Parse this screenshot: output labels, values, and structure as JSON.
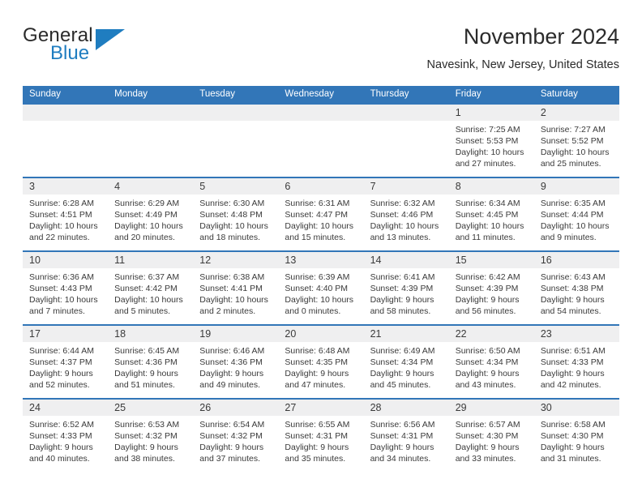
{
  "logo": {
    "word_general": "General",
    "word_blue": "Blue",
    "triangle": "triangle-mark"
  },
  "header": {
    "title": "November 2024",
    "subtitle": "Navesink, New Jersey, United States"
  },
  "colors": {
    "header_blue": "#3276b8",
    "daynum_band": "#efeff0",
    "text": "#3a3a3a",
    "logo_blue": "#1f7dc0"
  },
  "weekday_headers": [
    "Sunday",
    "Monday",
    "Tuesday",
    "Wednesday",
    "Thursday",
    "Friday",
    "Saturday"
  ],
  "labels": {
    "sunrise_prefix": "Sunrise:",
    "sunset_prefix": "Sunset:",
    "daylight_prefix": "Daylight:"
  },
  "weeks": [
    [
      {
        "day": "",
        "sunrise": "",
        "sunset": "",
        "daylight_line1": "",
        "daylight_line2": ""
      },
      {
        "day": "",
        "sunrise": "",
        "sunset": "",
        "daylight_line1": "",
        "daylight_line2": ""
      },
      {
        "day": "",
        "sunrise": "",
        "sunset": "",
        "daylight_line1": "",
        "daylight_line2": ""
      },
      {
        "day": "",
        "sunrise": "",
        "sunset": "",
        "daylight_line1": "",
        "daylight_line2": ""
      },
      {
        "day": "",
        "sunrise": "",
        "sunset": "",
        "daylight_line1": "",
        "daylight_line2": ""
      },
      {
        "day": "1",
        "sunrise": "Sunrise: 7:25 AM",
        "sunset": "Sunset: 5:53 PM",
        "daylight_line1": "Daylight: 10 hours",
        "daylight_line2": "and 27 minutes."
      },
      {
        "day": "2",
        "sunrise": "Sunrise: 7:27 AM",
        "sunset": "Sunset: 5:52 PM",
        "daylight_line1": "Daylight: 10 hours",
        "daylight_line2": "and 25 minutes."
      }
    ],
    [
      {
        "day": "3",
        "sunrise": "Sunrise: 6:28 AM",
        "sunset": "Sunset: 4:51 PM",
        "daylight_line1": "Daylight: 10 hours",
        "daylight_line2": "and 22 minutes."
      },
      {
        "day": "4",
        "sunrise": "Sunrise: 6:29 AM",
        "sunset": "Sunset: 4:49 PM",
        "daylight_line1": "Daylight: 10 hours",
        "daylight_line2": "and 20 minutes."
      },
      {
        "day": "5",
        "sunrise": "Sunrise: 6:30 AM",
        "sunset": "Sunset: 4:48 PM",
        "daylight_line1": "Daylight: 10 hours",
        "daylight_line2": "and 18 minutes."
      },
      {
        "day": "6",
        "sunrise": "Sunrise: 6:31 AM",
        "sunset": "Sunset: 4:47 PM",
        "daylight_line1": "Daylight: 10 hours",
        "daylight_line2": "and 15 minutes."
      },
      {
        "day": "7",
        "sunrise": "Sunrise: 6:32 AM",
        "sunset": "Sunset: 4:46 PM",
        "daylight_line1": "Daylight: 10 hours",
        "daylight_line2": "and 13 minutes."
      },
      {
        "day": "8",
        "sunrise": "Sunrise: 6:34 AM",
        "sunset": "Sunset: 4:45 PM",
        "daylight_line1": "Daylight: 10 hours",
        "daylight_line2": "and 11 minutes."
      },
      {
        "day": "9",
        "sunrise": "Sunrise: 6:35 AM",
        "sunset": "Sunset: 4:44 PM",
        "daylight_line1": "Daylight: 10 hours",
        "daylight_line2": "and 9 minutes."
      }
    ],
    [
      {
        "day": "10",
        "sunrise": "Sunrise: 6:36 AM",
        "sunset": "Sunset: 4:43 PM",
        "daylight_line1": "Daylight: 10 hours",
        "daylight_line2": "and 7 minutes."
      },
      {
        "day": "11",
        "sunrise": "Sunrise: 6:37 AM",
        "sunset": "Sunset: 4:42 PM",
        "daylight_line1": "Daylight: 10 hours",
        "daylight_line2": "and 5 minutes."
      },
      {
        "day": "12",
        "sunrise": "Sunrise: 6:38 AM",
        "sunset": "Sunset: 4:41 PM",
        "daylight_line1": "Daylight: 10 hours",
        "daylight_line2": "and 2 minutes."
      },
      {
        "day": "13",
        "sunrise": "Sunrise: 6:39 AM",
        "sunset": "Sunset: 4:40 PM",
        "daylight_line1": "Daylight: 10 hours",
        "daylight_line2": "and 0 minutes."
      },
      {
        "day": "14",
        "sunrise": "Sunrise: 6:41 AM",
        "sunset": "Sunset: 4:39 PM",
        "daylight_line1": "Daylight: 9 hours",
        "daylight_line2": "and 58 minutes."
      },
      {
        "day": "15",
        "sunrise": "Sunrise: 6:42 AM",
        "sunset": "Sunset: 4:39 PM",
        "daylight_line1": "Daylight: 9 hours",
        "daylight_line2": "and 56 minutes."
      },
      {
        "day": "16",
        "sunrise": "Sunrise: 6:43 AM",
        "sunset": "Sunset: 4:38 PM",
        "daylight_line1": "Daylight: 9 hours",
        "daylight_line2": "and 54 minutes."
      }
    ],
    [
      {
        "day": "17",
        "sunrise": "Sunrise: 6:44 AM",
        "sunset": "Sunset: 4:37 PM",
        "daylight_line1": "Daylight: 9 hours",
        "daylight_line2": "and 52 minutes."
      },
      {
        "day": "18",
        "sunrise": "Sunrise: 6:45 AM",
        "sunset": "Sunset: 4:36 PM",
        "daylight_line1": "Daylight: 9 hours",
        "daylight_line2": "and 51 minutes."
      },
      {
        "day": "19",
        "sunrise": "Sunrise: 6:46 AM",
        "sunset": "Sunset: 4:36 PM",
        "daylight_line1": "Daylight: 9 hours",
        "daylight_line2": "and 49 minutes."
      },
      {
        "day": "20",
        "sunrise": "Sunrise: 6:48 AM",
        "sunset": "Sunset: 4:35 PM",
        "daylight_line1": "Daylight: 9 hours",
        "daylight_line2": "and 47 minutes."
      },
      {
        "day": "21",
        "sunrise": "Sunrise: 6:49 AM",
        "sunset": "Sunset: 4:34 PM",
        "daylight_line1": "Daylight: 9 hours",
        "daylight_line2": "and 45 minutes."
      },
      {
        "day": "22",
        "sunrise": "Sunrise: 6:50 AM",
        "sunset": "Sunset: 4:34 PM",
        "daylight_line1": "Daylight: 9 hours",
        "daylight_line2": "and 43 minutes."
      },
      {
        "day": "23",
        "sunrise": "Sunrise: 6:51 AM",
        "sunset": "Sunset: 4:33 PM",
        "daylight_line1": "Daylight: 9 hours",
        "daylight_line2": "and 42 minutes."
      }
    ],
    [
      {
        "day": "24",
        "sunrise": "Sunrise: 6:52 AM",
        "sunset": "Sunset: 4:33 PM",
        "daylight_line1": "Daylight: 9 hours",
        "daylight_line2": "and 40 minutes."
      },
      {
        "day": "25",
        "sunrise": "Sunrise: 6:53 AM",
        "sunset": "Sunset: 4:32 PM",
        "daylight_line1": "Daylight: 9 hours",
        "daylight_line2": "and 38 minutes."
      },
      {
        "day": "26",
        "sunrise": "Sunrise: 6:54 AM",
        "sunset": "Sunset: 4:32 PM",
        "daylight_line1": "Daylight: 9 hours",
        "daylight_line2": "and 37 minutes."
      },
      {
        "day": "27",
        "sunrise": "Sunrise: 6:55 AM",
        "sunset": "Sunset: 4:31 PM",
        "daylight_line1": "Daylight: 9 hours",
        "daylight_line2": "and 35 minutes."
      },
      {
        "day": "28",
        "sunrise": "Sunrise: 6:56 AM",
        "sunset": "Sunset: 4:31 PM",
        "daylight_line1": "Daylight: 9 hours",
        "daylight_line2": "and 34 minutes."
      },
      {
        "day": "29",
        "sunrise": "Sunrise: 6:57 AM",
        "sunset": "Sunset: 4:30 PM",
        "daylight_line1": "Daylight: 9 hours",
        "daylight_line2": "and 33 minutes."
      },
      {
        "day": "30",
        "sunrise": "Sunrise: 6:58 AM",
        "sunset": "Sunset: 4:30 PM",
        "daylight_line1": "Daylight: 9 hours",
        "daylight_line2": "and 31 minutes."
      }
    ]
  ]
}
